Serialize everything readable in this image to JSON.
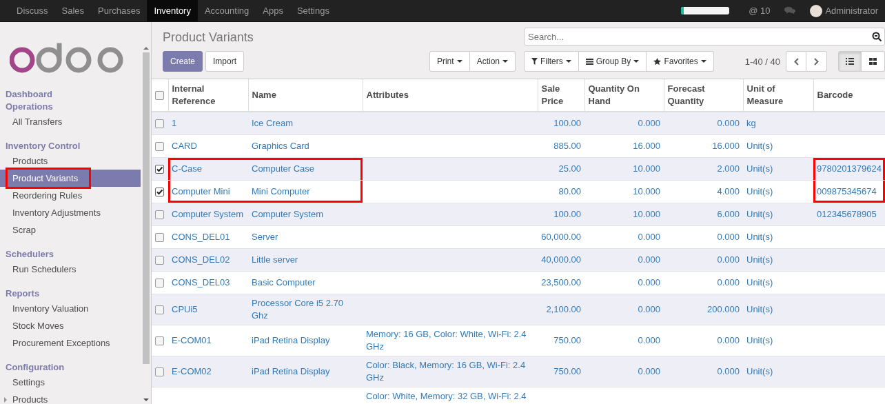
{
  "topbar": {
    "apps": [
      {
        "label": "Discuss",
        "selected": false
      },
      {
        "label": "Sales",
        "selected": false
      },
      {
        "label": "Purchases",
        "selected": false
      },
      {
        "label": "Inventory",
        "selected": true
      },
      {
        "label": "Accounting",
        "selected": false
      },
      {
        "label": "Apps",
        "selected": false
      },
      {
        "label": "Settings",
        "selected": false
      }
    ],
    "progress": {
      "level": 0.05
    },
    "mentions": "@ 10",
    "user": "Administrator"
  },
  "sidebar": {
    "sections": [
      {
        "title": "Dashboard"
      },
      {
        "title": "Operations",
        "items": [
          {
            "label": "All Transfers",
            "selected": false,
            "annotated": false
          }
        ]
      },
      {
        "title": "Inventory Control",
        "items": [
          {
            "label": "Products",
            "selected": false,
            "annotated": false
          },
          {
            "label": "Product Variants",
            "selected": true,
            "annotated": true
          },
          {
            "label": "Reordering Rules",
            "selected": false,
            "annotated": false
          },
          {
            "label": "Inventory Adjustments",
            "selected": false,
            "annotated": false
          },
          {
            "label": "Scrap",
            "selected": false,
            "annotated": false
          }
        ]
      },
      {
        "title": "Schedulers",
        "items": [
          {
            "label": "Run Schedulers",
            "selected": false,
            "annotated": false
          }
        ]
      },
      {
        "title": "Reports",
        "items": [
          {
            "label": "Inventory Valuation",
            "selected": false,
            "annotated": false
          },
          {
            "label": "Stock Moves",
            "selected": false,
            "annotated": false
          },
          {
            "label": "Procurement Exceptions",
            "selected": false,
            "annotated": false
          }
        ]
      },
      {
        "title": "Configuration",
        "items": [
          {
            "label": "Settings",
            "selected": false,
            "annotated": false
          },
          {
            "label": "Products",
            "selected": false,
            "annotated": false,
            "expandable": true
          }
        ]
      }
    ]
  },
  "control_panel": {
    "title": "Product Variants",
    "create": "Create",
    "import": "Import",
    "print": "Print",
    "action": "Action",
    "search": {
      "placeholder": "Search..."
    },
    "filters": "Filters",
    "group_by": "Group By",
    "favorites": "Favorites",
    "pager": "1-40 / 40",
    "views": [
      {
        "kind": "list",
        "selected": true
      },
      {
        "kind": "kanban",
        "selected": false
      }
    ]
  },
  "table": {
    "select_all": {
      "checked": false
    },
    "columns": [
      {
        "label": "Internal Reference",
        "kind": "text"
      },
      {
        "label": "Name",
        "kind": "text"
      },
      {
        "label": "Attributes",
        "kind": "text"
      },
      {
        "label": "Sale Price",
        "kind": "number"
      },
      {
        "label": "Quantity On Hand",
        "kind": "number"
      },
      {
        "label": "Forecast Quantity",
        "kind": "number"
      },
      {
        "label": "Unit of Measure",
        "kind": "text"
      },
      {
        "label": "Barcode",
        "kind": "text"
      }
    ],
    "rows": [
      {
        "checked": false,
        "annotated_name": false,
        "annotated_barcode": false,
        "cells": [
          "1",
          "Ice Cream",
          "",
          "100.00",
          "0.000",
          "0.000",
          "kg",
          ""
        ]
      },
      {
        "checked": false,
        "annotated_name": false,
        "annotated_barcode": false,
        "cells": [
          "CARD",
          "Graphics Card",
          "",
          "885.00",
          "16.000",
          "16.000",
          "Unit(s)",
          ""
        ]
      },
      {
        "checked": true,
        "annotated_name": true,
        "annotated_barcode": true,
        "cells": [
          "C-Case",
          "Computer Case",
          "",
          "25.00",
          "10.000",
          "2.000",
          "Unit(s)",
          "9780201379624"
        ]
      },
      {
        "checked": true,
        "annotated_name": true,
        "annotated_barcode": true,
        "cells": [
          "Computer Mini",
          "Mini Computer",
          "",
          "80.00",
          "10.000",
          "4.000",
          "Unit(s)",
          "009875345674"
        ]
      },
      {
        "checked": false,
        "annotated_name": false,
        "annotated_barcode": false,
        "cells": [
          "Computer System",
          "Computer System",
          "",
          "100.00",
          "10.000",
          "6.000",
          "Unit(s)",
          "012345678905"
        ]
      },
      {
        "checked": false,
        "annotated_name": false,
        "annotated_barcode": false,
        "cells": [
          "CONS_DEL01",
          "Server",
          "",
          "60,000.00",
          "0.000",
          "0.000",
          "Unit(s)",
          ""
        ]
      },
      {
        "checked": false,
        "annotated_name": false,
        "annotated_barcode": false,
        "cells": [
          "CONS_DEL02",
          "Little server",
          "",
          "40,000.00",
          "0.000",
          "0.000",
          "Unit(s)",
          ""
        ]
      },
      {
        "checked": false,
        "annotated_name": false,
        "annotated_barcode": false,
        "cells": [
          "CONS_DEL03",
          "Basic Computer",
          "",
          "23,500.00",
          "0.000",
          "0.000",
          "Unit(s)",
          ""
        ]
      },
      {
        "checked": false,
        "annotated_name": false,
        "annotated_barcode": false,
        "cells": [
          "CPUi5",
          "Processor Core i5 2.70 Ghz",
          "",
          "2,100.00",
          "0.000",
          "200.000",
          "Unit(s)",
          ""
        ]
      },
      {
        "checked": false,
        "annotated_name": false,
        "annotated_barcode": false,
        "cells": [
          "E-COM01",
          "iPad Retina Display",
          "Memory: 16 GB, Color: White, Wi-Fi: 2.4 GHz",
          "750.00",
          "0.000",
          "0.000",
          "Unit(s)",
          ""
        ]
      },
      {
        "checked": false,
        "annotated_name": false,
        "annotated_barcode": false,
        "cells": [
          "E-COM02",
          "iPad Retina Display",
          "Color: Black, Memory: 16 GB, Wi-Fi: 2.4 GHz",
          "750.00",
          "0.000",
          "0.000",
          "Unit(s)",
          ""
        ]
      }
    ],
    "cut_off_row": {
      "attributes": "Color: White, Memory: 32 GB, Wi-Fi: 2.4"
    }
  }
}
